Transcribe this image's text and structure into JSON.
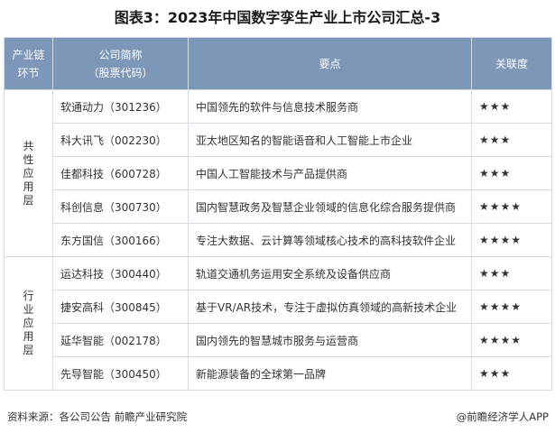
{
  "title": "图表3：2023年中国数字孪生产业上市公司汇总-3",
  "header": {
    "segment_line1": "产业链",
    "segment_line2": "环节",
    "company_line1": "公司简称",
    "company_line2": "（股票代码）",
    "points": "要点",
    "relevance": "关联度"
  },
  "groups": [
    {
      "segment": "共性应用层",
      "rows": [
        {
          "company": "软通动力（301236）",
          "point": "中国领先的软件与信息技术服务商",
          "relevance": "★★★"
        },
        {
          "company": "科大讯飞（002230）",
          "point": "亚太地区知名的智能语音和人工智能上市企业",
          "relevance": "★★★"
        },
        {
          "company": "佳都科技（600728）",
          "point": "中国人工智能技术与产品提供商",
          "relevance": "★★★"
        },
        {
          "company": "科创信息（300730）",
          "point": "国内智慧政务及智慧企业领域的信息化综合服务提供商",
          "relevance": "★★★★"
        },
        {
          "company": "东方国信（300166）",
          "point": "专注大数据、云计算等领域核心技术的高科技软件企业",
          "relevance": "★★★★"
        }
      ]
    },
    {
      "segment": "行业应用层",
      "rows": [
        {
          "company": "运达科技（300440）",
          "point": "轨道交通机务运用安全系统及设备供应商",
          "relevance": "★★★"
        },
        {
          "company": "捷安高科（300845）",
          "point": "基于VR/AR技术，专注于虚拟仿真领域的高新技术企业",
          "relevance": "★★★★"
        },
        {
          "company": "延华智能（002178）",
          "point": "国内领先的智慧城市服务与运营商",
          "relevance": "★★★★"
        },
        {
          "company": "先导智能（300450）",
          "point": "新能源装备的全球第一品牌",
          "relevance": "★★★"
        }
      ]
    }
  ],
  "footer": {
    "source": "资料来源：各公司公告 前瞻产业研究院",
    "credit": "@前瞻经济学人APP"
  }
}
